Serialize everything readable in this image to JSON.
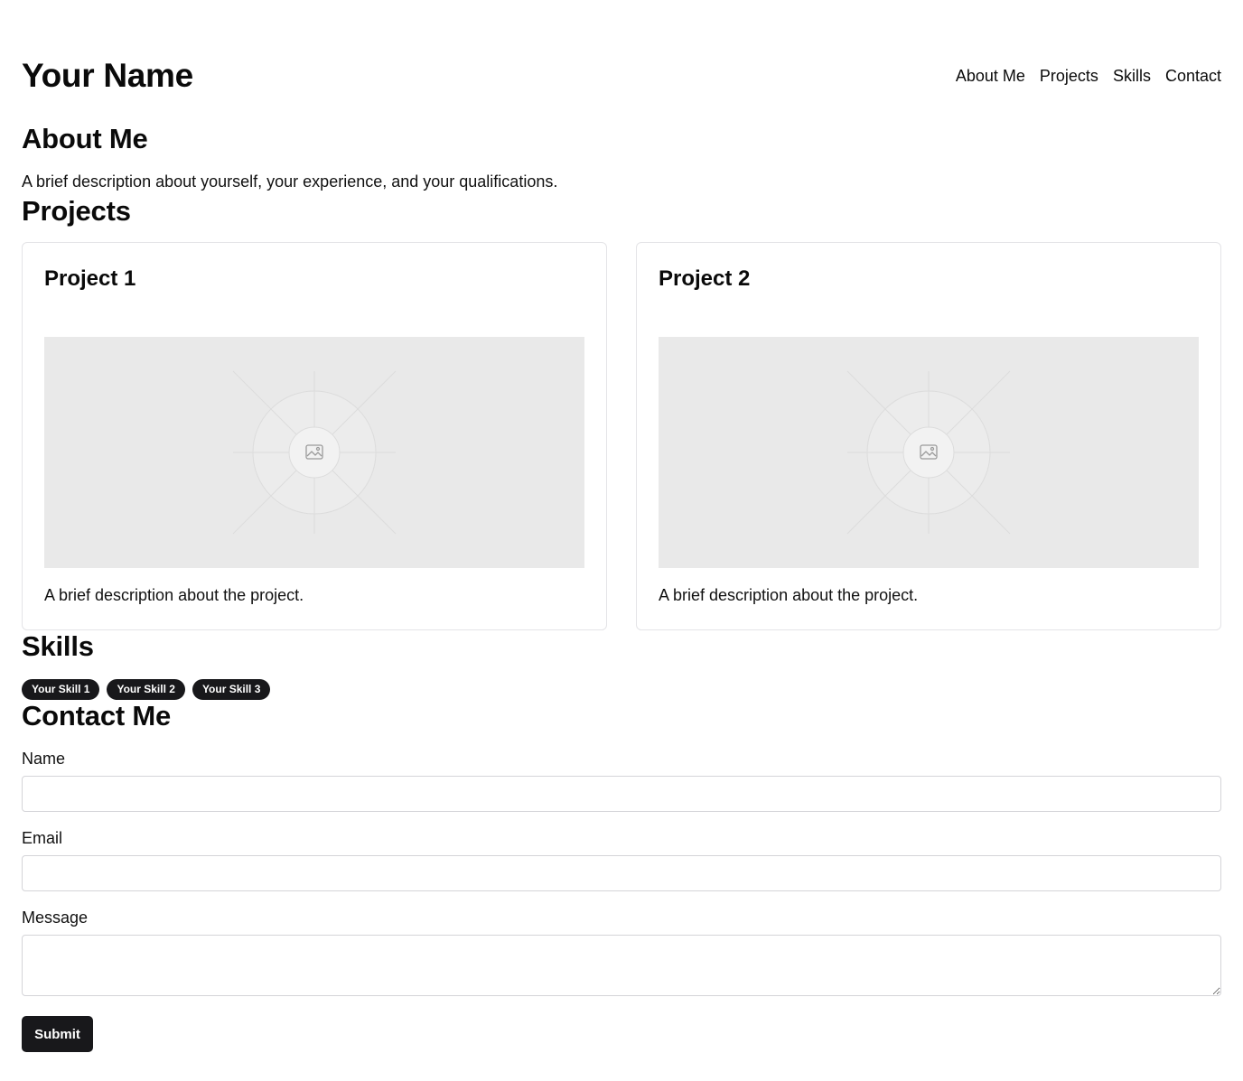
{
  "header": {
    "title": "Your Name",
    "nav": [
      "About Me",
      "Projects",
      "Skills",
      "Contact"
    ]
  },
  "about": {
    "title": "About Me",
    "text": "A brief description about yourself, your experience, and your qualifications."
  },
  "projects": {
    "title": "Projects",
    "items": [
      {
        "title": "Project 1",
        "image_icon": "image-placeholder-icon",
        "description": "A brief description about the project."
      },
      {
        "title": "Project 2",
        "image_icon": "image-placeholder-icon",
        "description": "A brief description about the project."
      }
    ]
  },
  "skills": {
    "title": "Skills",
    "items": [
      "Your Skill 1",
      "Your Skill 2",
      "Your Skill 3"
    ]
  },
  "contact": {
    "title": "Contact Me",
    "name_label": "Name",
    "name_value": "",
    "email_label": "Email",
    "email_value": "",
    "message_label": "Message",
    "message_value": "",
    "submit_label": "Submit"
  },
  "colors": {
    "text": "#0a0a0a",
    "badge_bg": "#18181b",
    "button_bg": "#18181b",
    "border": "#e4e4e7",
    "placeholder_bg": "#e9e9e9"
  }
}
